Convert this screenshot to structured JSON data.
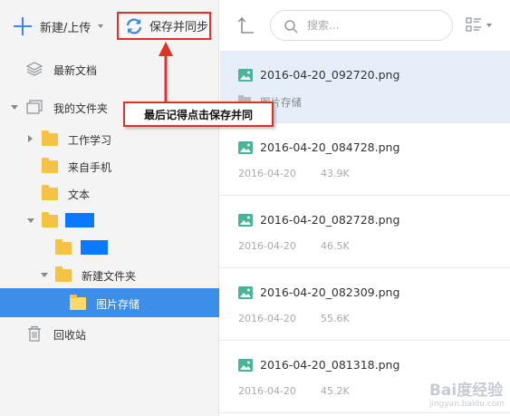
{
  "toolbar": {
    "new_upload_label": "新建/上传",
    "save_sync_label": "保存并同步"
  },
  "sidebar": {
    "items": [
      {
        "label": "最新文档"
      },
      {
        "label": "我的文件夹"
      },
      {
        "label": "工作学习"
      },
      {
        "label": "来自手机"
      },
      {
        "label": "文本"
      },
      {
        "label": "新建文件夹"
      },
      {
        "label": "图片存储"
      },
      {
        "label": "回收站"
      }
    ]
  },
  "search": {
    "placeholder": "搜索...",
    "value": ""
  },
  "files": [
    {
      "name": "2016-04-20_092720.png",
      "folder": "图片存储"
    },
    {
      "name": "2016-04-20_084728.png",
      "date": "2016-04-20",
      "size": "43.9K"
    },
    {
      "name": "2016-04-20_082728.png",
      "date": "2016-04-20",
      "size": "46.5K"
    },
    {
      "name": "2016-04-20_082309.png",
      "date": "2016-04-20",
      "size": "55.6K"
    },
    {
      "name": "2016-04-20_081318.png",
      "date": "2016-04-20",
      "size": "45.2K"
    }
  ],
  "annotation": {
    "callout_text": "最后记得点击保存并同"
  },
  "watermark": {
    "text": "Bai度经验",
    "sub": "jingyan.baidu.com"
  },
  "colors": {
    "accent": "#3d8ee8",
    "highlight_border": "#e0312b",
    "folder": "#f6c244",
    "selected_row": "#e6eefa",
    "redaction": "#0a78ff"
  }
}
